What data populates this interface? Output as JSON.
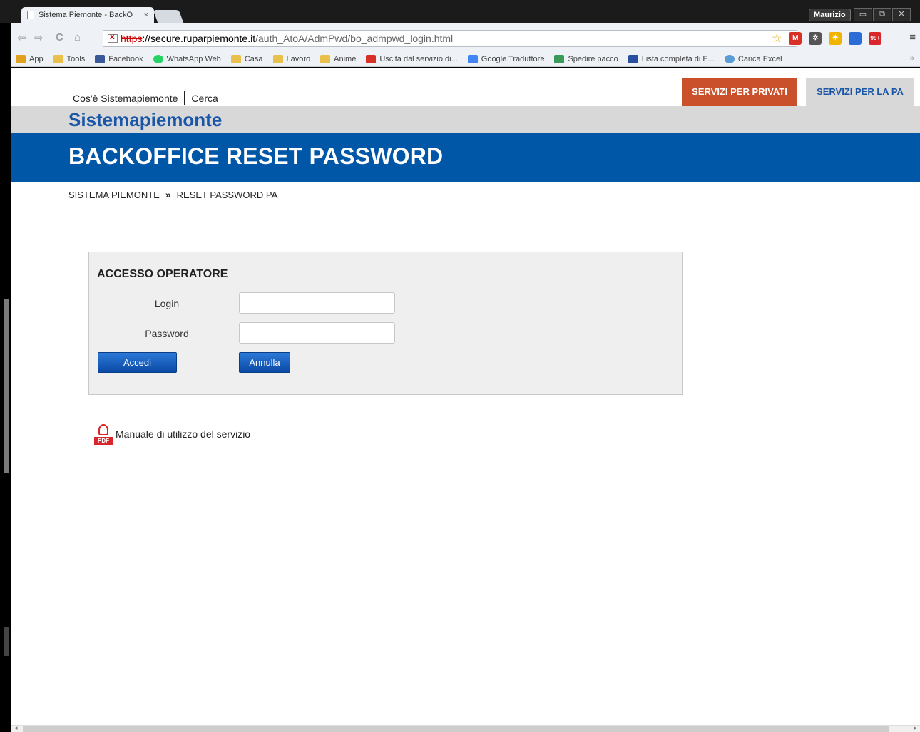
{
  "browser": {
    "tab_title": "Sistema Piemonte - BackO",
    "tab_close": "×",
    "profile_name": "Maurizio",
    "window_buttons": [
      "▭",
      "⧉",
      "✕"
    ],
    "url": {
      "scheme": "https",
      "rest_host": "://secure.ruparpiemonte.it",
      "path": "/auth_AtoA/AdmPwd/bo_admpwd_login.html"
    },
    "nav": {
      "back": "⇦",
      "forward": "⇨",
      "reload": "C",
      "home": "⌂"
    },
    "star": "☆",
    "menu": "≡",
    "extensions": [
      {
        "name": "gmail-icon",
        "label": "M",
        "color": "#d93025"
      },
      {
        "name": "puzzle-icon",
        "label": "✲",
        "color": "#555555"
      },
      {
        "name": "weather-icon",
        "label": "☀",
        "color": "#f0b400"
      },
      {
        "name": "screen-icon",
        "label": "",
        "color": "#2b6cd6"
      },
      {
        "name": "counter-icon",
        "label": "99+",
        "color": "#d9262b"
      }
    ],
    "bookmarks": [
      {
        "label": "App",
        "icon": "apps-icon",
        "color": "#e0a020"
      },
      {
        "label": "Tools",
        "icon": "folder-icon",
        "color": "#e8c04a"
      },
      {
        "label": "Facebook",
        "icon": "facebook-icon",
        "color": "#3b5998"
      },
      {
        "label": "WhatsApp Web",
        "icon": "whatsapp-icon",
        "color": "#25d366"
      },
      {
        "label": "Casa",
        "icon": "folder-icon",
        "color": "#e8c04a"
      },
      {
        "label": "Lavoro",
        "icon": "folder-icon",
        "color": "#e8c04a"
      },
      {
        "label": "Anime",
        "icon": "folder-icon",
        "color": "#e8c04a"
      },
      {
        "label": "Uscita dal servizio di...",
        "icon": "exit-icon",
        "color": "#d93025"
      },
      {
        "label": "Google Traduttore",
        "icon": "translate-icon",
        "color": "#4285f4"
      },
      {
        "label": "Spedire pacco",
        "icon": "package-icon",
        "color": "#3a9a5a"
      },
      {
        "label": "Lista completa di E...",
        "icon": "tf-icon",
        "color": "#2b4fa0"
      },
      {
        "label": "Carica Excel",
        "icon": "excel-icon",
        "color": "#5a9cd6"
      }
    ],
    "bookmarks_more": "»"
  },
  "site": {
    "topnav": {
      "about": "Cos'è Sistemapiemonte",
      "search": "Cerca"
    },
    "btn_privati": "SERVIZI PER PRIVATI",
    "btn_pa": "SERVIZI PER LA PA",
    "brand": "Sistemapiemonte",
    "page_title": "BACKOFFICE RESET PASSWORD",
    "breadcrumb": {
      "home": "SISTEMA PIEMONTE",
      "sep": "»",
      "current": "RESET PASSWORD PA"
    },
    "colors": {
      "blue": "#0057a8",
      "orange": "#c9502a",
      "brand": "#1a56a8"
    }
  },
  "login": {
    "heading": "ACCESSO OPERATORE",
    "login_label": "Login",
    "login_value": "",
    "password_label": "Password",
    "password_value": "",
    "accedi": "Accedi",
    "annulla": "Annulla"
  },
  "manual": {
    "label": "Manuale di utilizzo del servizio",
    "tag": "PDF"
  }
}
